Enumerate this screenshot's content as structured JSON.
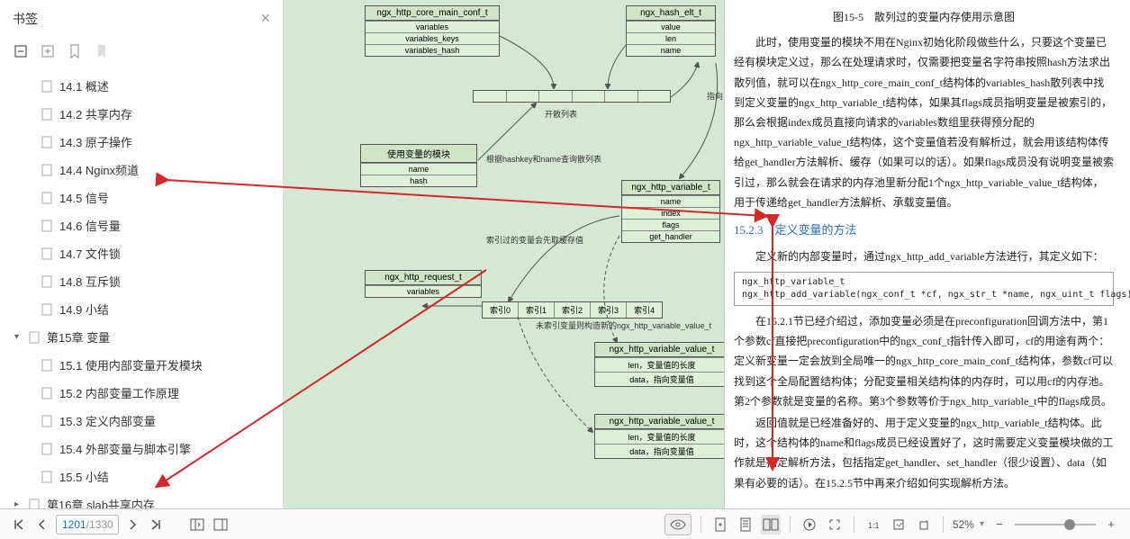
{
  "sidebar": {
    "title": "书签",
    "items": [
      {
        "label": "14.1 概述",
        "level": 1
      },
      {
        "label": "14.2 共享内存",
        "level": 1
      },
      {
        "label": "14.3 原子操作",
        "level": 1
      },
      {
        "label": "14.4 Nginx频道",
        "level": 1
      },
      {
        "label": "14.5 信号",
        "level": 1
      },
      {
        "label": "14.6 信号量",
        "level": 1
      },
      {
        "label": "14.7 文件锁",
        "level": 1
      },
      {
        "label": "14.8 互斥锁",
        "level": 1
      },
      {
        "label": "14.9 小结",
        "level": 1
      },
      {
        "label": "第15章 变量",
        "level": 0,
        "expanded": true
      },
      {
        "label": "15.1 使用内部变量开发模块",
        "level": 1
      },
      {
        "label": "15.2 内部变量工作原理",
        "level": 1
      },
      {
        "label": "15.3 定义内部变量",
        "level": 1
      },
      {
        "label": "15.4 外部变量与脚本引擎",
        "level": 1
      },
      {
        "label": "15.5 小结",
        "level": 1
      },
      {
        "label": "第16章 slab共享内存",
        "level": 0,
        "expanded": false
      }
    ]
  },
  "diagram": {
    "boxes": {
      "core_conf": {
        "title": "ngx_http_core_main_conf_t",
        "rows": [
          "variables",
          "variables_keys",
          "variables_hash"
        ]
      },
      "hash_elt": {
        "title": "ngx_hash_elt_t",
        "rows": [
          "value",
          "len",
          "name"
        ]
      },
      "use_var": {
        "title": "使用变量的模块",
        "rows": [
          "name",
          "hash"
        ]
      },
      "request": {
        "title": "ngx_http_request_t",
        "rows": [
          "variables"
        ]
      },
      "variable": {
        "title": "ngx_http_variable_t",
        "rows": [
          "name",
          "index",
          "flags",
          "get_handler"
        ]
      },
      "value1": {
        "title": "ngx_http_variable_value_t",
        "rows": [
          "len，变量值的长度",
          "data，指向变量值"
        ]
      },
      "value2": {
        "title": "ngx_http_variable_value_t",
        "rows": [
          "len，变量值的长度",
          "data，指向变量值"
        ]
      }
    },
    "labels": {
      "hash_list": "开散列表",
      "hash_query": "根据hashkey和name查询散列表",
      "cache_note": "索引过的变量会先取缓存值",
      "new_note": "未索引变量则构造新的ngx_http_variable_value_t",
      "point": "指向",
      "idx": [
        "索引0",
        "索引1",
        "索引2",
        "索引3",
        "索引4"
      ]
    }
  },
  "content": {
    "caption": "图15-5　散列过的变量内存使用示意图",
    "p1": "此时，使用变量的模块不用在Nginx初始化阶段做些什么，只要这个变量已经有模块定义过，那么在处理请求时，仅需要把变量名字符串按照hash方法求出散列值，就可以在ngx_http_core_main_conf_t结构体的variables_hash散列表中找到定义变量的ngx_http_variable_t结构体，如果其flags成员指明变量是被索引的，那么会根据index成员直接向请求的variables数组里获得预分配的ngx_http_variable_value_t结构体，这个变量值若没有解析过，就会用该结构体传给get_handler方法解析、缓存（如果可以的话）。如果flags成员没有说明变量被索引过，那么就会在请求的内存池里新分配1个ngx_http_variable_value_t结构体，用于传递给get_handler方法解析、承载变量值。",
    "section_num": "15.2.3",
    "section_title": "定义变量的方法",
    "p2": "定义新的内部变量时，通过ngx_http_add_variable方法进行，其定义如下：",
    "code": "ngx_http_variable_t\nngx_http_add_variable(ngx_conf_t *cf, ngx_str_t *name, ngx_uint_t flags);",
    "p3": "在15.2.1节已经介绍过，添加变量必须是在preconfiguration回调方法中，第1个参数cf直接把preconfiguration中的ngx_conf_t指针传入即可，cf的用途有两个：定义新变量一定会放到全局唯一的ngx_http_core_main_conf_t结构体，参数cf可以找到这个全局配置结构体；分配变量相关结构体的内存时，可以用cf的内存池。第2个参数就是变量的名称。第3个参数等价于ngx_http_variable_t中的flags成员。",
    "p4": "返回值就是已经准备好的、用于定义变量的ngx_http_variable_t结构体。此时，这个结构体的name和flags成员已经设置好了，这时需要定义变量模块做的工作就是指定解析方法，包括指定get_handler、set_handler（很少设置）、data（如果有必要的话）。在15.2.5节中再来介绍如何实现解析方法。"
  },
  "footer": {
    "current_page": "1201",
    "total_pages": "/1330",
    "zoom": "52%"
  }
}
